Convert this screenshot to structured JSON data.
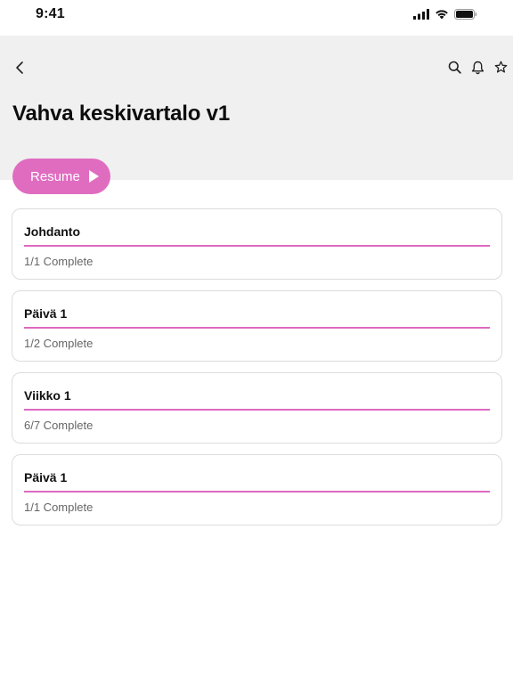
{
  "status_bar": {
    "time": "9:41",
    "icons": [
      "cellular-signal-icon",
      "wifi-icon",
      "battery-icon"
    ]
  },
  "header": {
    "title": "Vahva keskivartalo v1",
    "back_icon": "chevron-left-icon",
    "actions": [
      "search-icon",
      "bell-icon",
      "star-icon"
    ]
  },
  "resume_button": {
    "label": "Resume",
    "icon": "play-icon"
  },
  "colors": {
    "accent": "#e06cc0",
    "progress": "#dd69c0",
    "header_bg": "#f0f0f0"
  },
  "sections": [
    {
      "title": "Johdanto",
      "status": "1/1 Complete",
      "progress": 1.0
    },
    {
      "title": "Päivä 1",
      "status": "1/2 Complete",
      "progress": 1.0
    },
    {
      "title": "Viikko 1",
      "status": "6/7 Complete",
      "progress": 1.0
    },
    {
      "title": "Päivä 1",
      "status": "1/1 Complete",
      "progress": 1.0
    }
  ]
}
